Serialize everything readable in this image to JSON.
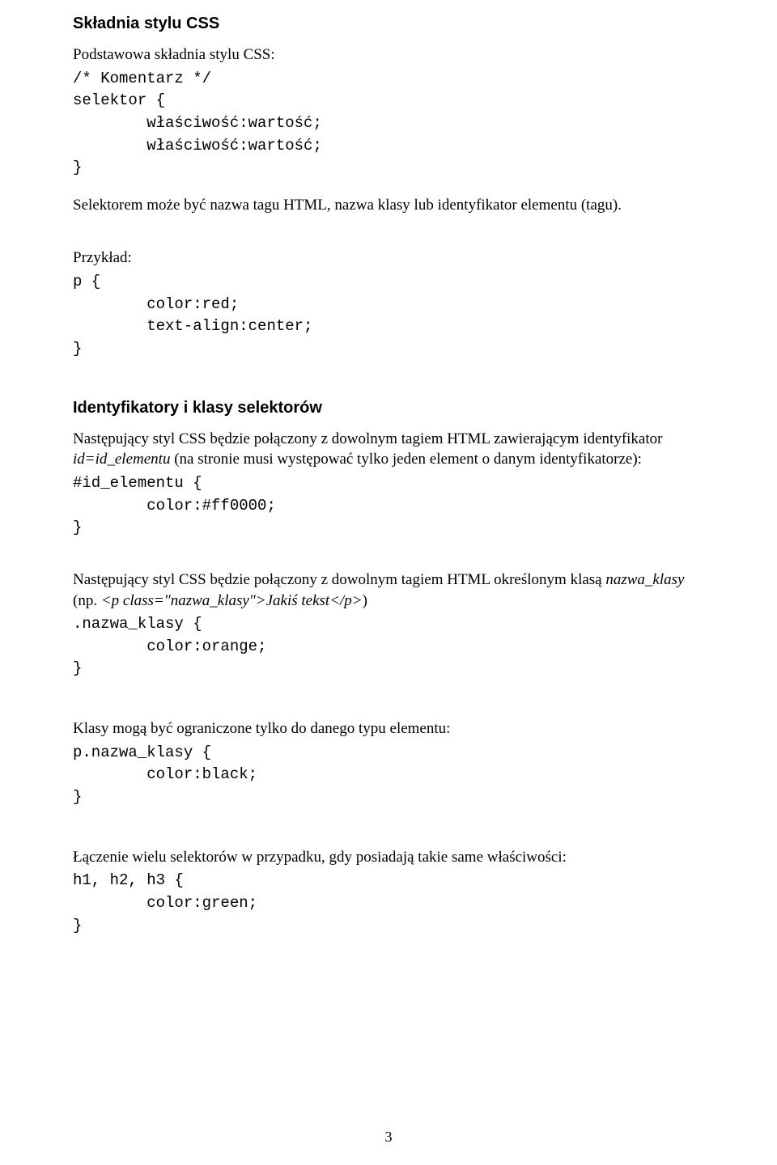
{
  "sec1": {
    "heading": "Składnia stylu CSS",
    "intro": "Podstawowa składnia stylu CSS:",
    "code1": "/* Komentarz */",
    "code2": "selektor {",
    "code3": "        właściwość:wartość;",
    "code4": "        właściwość:wartość;",
    "code5": "}",
    "para2": "Selektorem może być nazwa tagu HTML, nazwa klasy lub identyfikator elementu (tagu).",
    "example_label": "Przykład:",
    "ex1": "p {",
    "ex2": "        color:red;",
    "ex3": "        text-align:center;",
    "ex4": "}"
  },
  "sec2": {
    "heading": "Identyfikatory i klasy selektorów",
    "p1a": "Następujący styl CSS będzie połączony z dowolnym tagiem HTML zawierającym identyfikator ",
    "p1_em": "id=id_elementu",
    "p1b": " (na stronie musi występować tylko jeden element o danym identyfikatorze):",
    "c1": "#id_elementu {",
    "c2": "        color:#ff0000;",
    "c3": "}",
    "p2a": "Następujący styl CSS będzie połączony z dowolnym tagiem HTML określonym klasą ",
    "p2_em": "nazwa_klasy",
    "p2b": " (np. ",
    "p2_em2": "<p class=\"nazwa_klasy\">Jakiś tekst</p>",
    "p2c": ")",
    "c4": ".nazwa_klasy {",
    "c5": "        color:orange;",
    "c6": "}",
    "p3": "Klasy mogą być ograniczone tylko do danego typu elementu:",
    "c7": "p.nazwa_klasy {",
    "c8": "        color:black;",
    "c9": "}",
    "p4": "Łączenie wielu selektorów w przypadku, gdy posiadają takie same właściwości:",
    "c10": "h1, h2, h3 {",
    "c11": "        color:green;",
    "c12": "}"
  },
  "page_number": "3"
}
